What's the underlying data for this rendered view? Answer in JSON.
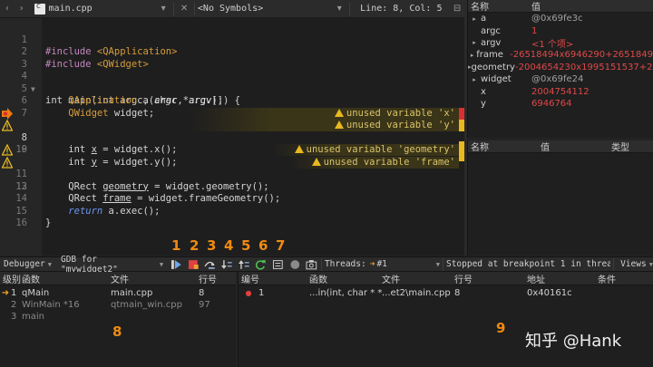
{
  "topbar": {
    "back": "‹",
    "forward": "›",
    "file": "main.cpp",
    "file_caret": "▾",
    "close": "✕",
    "symbols": "<No Symbols>",
    "symbols_caret": "▾",
    "position": "Line: 8, Col: 5",
    "split": "⊟"
  },
  "editor": {
    "lines": [
      {
        "n": "1"
      },
      {
        "n": "2"
      },
      {
        "n": "3"
      },
      {
        "n": "4"
      },
      {
        "n": "5"
      },
      {
        "n": "6"
      },
      {
        "n": "7"
      },
      {
        "n": "8"
      },
      {
        "n": "9"
      },
      {
        "n": "10"
      },
      {
        "n": "11"
      },
      {
        "n": "12"
      },
      {
        "n": "13"
      },
      {
        "n": "14"
      },
      {
        "n": "15"
      },
      {
        "n": "16"
      }
    ],
    "code": {
      "l1a": "#include ",
      "l1b": "<QApplication>",
      "l2a": "#include ",
      "l2b": "<QWidget>",
      "l4": "int main(int argc, char *argv[]) {",
      "l5a": "    ",
      "l5b": "QApplication",
      "l5c": " a(",
      "l5d": "argc",
      "l5e": ", ",
      "l5f": "argv",
      "l5g": ");",
      "l6a": "    ",
      "l6b": "QWidget",
      "l6c": " widget;",
      "l8a": "    int ",
      "l8b": "x",
      "l8c": " = widget.x();",
      "l9a": "    int ",
      "l9b": "y",
      "l9c": " = widget.y();",
      "l11a": "    QRect ",
      "l11b": "geometry",
      "l11c": " = widget.geometry();",
      "l12a": "    QRect ",
      "l12b": "frame",
      "l12c": " = widget.frameGeometry();",
      "l14a": "    ",
      "l14b": "return",
      "l14c": " a.exec();",
      "l15": "}"
    },
    "warnings": {
      "w8": "unused variable 'x'",
      "w9": "unused variable 'y'",
      "w11": "unused variable 'geometry'",
      "w12": "unused variable 'frame'"
    }
  },
  "locals": {
    "head_name": "名称",
    "head_value": "值",
    "rows": [
      {
        "name": "a",
        "value": "@0x69fe3c",
        "arrow": "▸"
      },
      {
        "name": "argc",
        "value": "1",
        "arrow": ""
      },
      {
        "name": "argv",
        "value": "<1 个项>",
        "arrow": "▸"
      },
      {
        "name": "frame",
        "value": "-26518494x6946290+2651849",
        "arrow": "▸"
      },
      {
        "name": "geometry",
        "value": "-2004654230x1995151537+20",
        "arrow": "▸"
      },
      {
        "name": "widget",
        "value": "@0x69fe24",
        "arrow": "▸"
      },
      {
        "name": "x",
        "value": "2004754112",
        "arrow": ""
      },
      {
        "name": "y",
        "value": "6946764",
        "arrow": ""
      }
    ]
  },
  "watch": {
    "head_name": "名称",
    "head_value": "值",
    "head_type": "类型"
  },
  "debugbar": {
    "debugger": "Debugger",
    "gdb": "GDB for \"mywidget2\"",
    "threads_label": "Threads:",
    "thread": "#1",
    "status": "Stopped at breakpoint 1 in thread 1.",
    "views": "Views"
  },
  "labels": {
    "n1": "1",
    "n2": "2",
    "n3": "3",
    "n4": "4",
    "n5": "5",
    "n6": "6",
    "n7": "7",
    "n8": "8",
    "n9": "9"
  },
  "stack": {
    "headers": [
      "级别",
      "函数",
      "文件",
      "行号"
    ],
    "rows": [
      {
        "level": "1",
        "func": "qMain",
        "file": "main.cpp",
        "line": "8"
      },
      {
        "level": "2",
        "func": "WinMain *16",
        "file": "qtmain_win.cpp",
        "line": "97"
      },
      {
        "level": "3",
        "func": "main",
        "file": "",
        "line": ""
      }
    ]
  },
  "breakpoints": {
    "headers": [
      "编号",
      "函数",
      "文件",
      "行号",
      "地址",
      "条件"
    ],
    "rows": [
      {
        "num": "1",
        "func": "...in(int, char * *)",
        "file": "...et2\\main.cpp",
        "line": "8",
        "addr": "0x40161c",
        "cond": ""
      }
    ]
  },
  "watermark": "知乎 @Hank"
}
